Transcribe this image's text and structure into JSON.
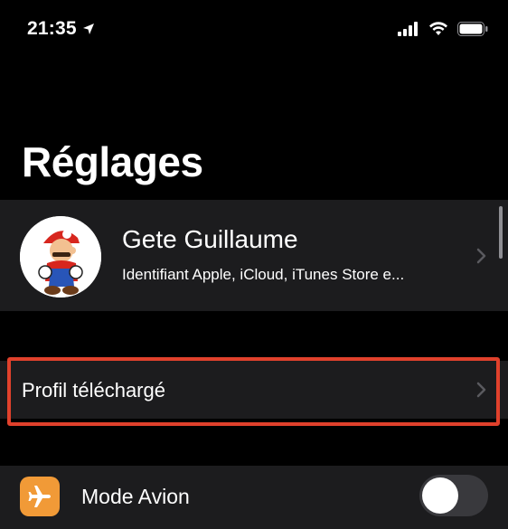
{
  "status_bar": {
    "time": "21:35",
    "location_icon": "location-arrow-icon",
    "signal_icon": "cellular-signal-icon",
    "wifi_icon": "wifi-icon",
    "battery_icon": "battery-icon"
  },
  "page": {
    "title": "Réglages"
  },
  "profile": {
    "name": "Gete Guillaume",
    "subtitle": "Identifiant Apple, iCloud, iTunes Store e...",
    "avatar_icon": "mario-avatar"
  },
  "rows": {
    "downloaded_profile_label": "Profil téléchargé",
    "airplane_mode_label": "Mode Avion",
    "airplane_mode_on": false
  },
  "colors": {
    "background": "#000000",
    "row_background": "#1c1c1e",
    "airplane_icon_bg": "#f19a37",
    "highlight_border": "#e0412c",
    "toggle_off": "#39393d"
  }
}
